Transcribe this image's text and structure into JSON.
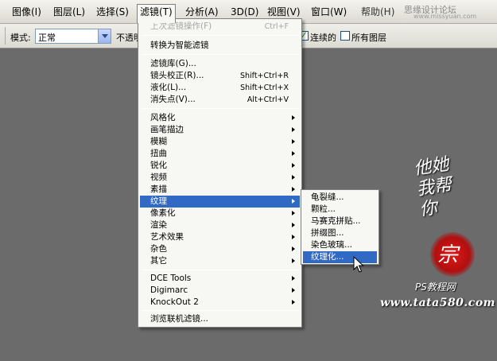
{
  "menubar": {
    "items": [
      "图像(I)",
      "图层(L)",
      "选择(S)",
      "滤镜(T)",
      "分析(A)",
      "3D(D)",
      "视图(V)",
      "窗口(W)",
      "帮助(H)"
    ],
    "active_index": 3
  },
  "site_tag": "思缘设计论坛",
  "site_tag_url": "www.missyuan.com",
  "options": {
    "mode_label": "模式:",
    "mode_value": "正常",
    "opacity_label": "不透明",
    "contiguous_label": "连续的",
    "contiguous_checked": true,
    "all_layers_label": "所有图层",
    "all_layers_checked": false
  },
  "filter_menu": {
    "last_filter": {
      "label": "上次滤镜操作(F)",
      "shortcut": "Ctrl+F",
      "disabled": true
    },
    "smart": "转换为智能滤镜",
    "group1": [
      {
        "label": "滤镜库(G)...",
        "shortcut": ""
      },
      {
        "label": "镜头校正(R)...",
        "shortcut": "Shift+Ctrl+R"
      },
      {
        "label": "液化(L)...",
        "shortcut": "Shift+Ctrl+X"
      },
      {
        "label": "消失点(V)...",
        "shortcut": "Alt+Ctrl+V"
      }
    ],
    "categories": [
      "风格化",
      "画笔描边",
      "模糊",
      "扭曲",
      "锐化",
      "视频",
      "素描",
      "纹理",
      "像素化",
      "渲染",
      "艺术效果",
      "杂色",
      "其它"
    ],
    "highlight_index": 7,
    "plugins": [
      "DCE Tools",
      "Digimarc",
      "KnockOut 2"
    ],
    "browse": "浏览联机滤镜..."
  },
  "texture_submenu": {
    "items": [
      "龟裂缝...",
      "颗粒...",
      "马赛克拼贴...",
      "拼缀图...",
      "染色玻璃...",
      "纹理化..."
    ],
    "highlight_index": 5
  },
  "watermark": {
    "calligraphy": "他她我帮你",
    "seal": "宗",
    "brand": "PS教程网",
    "url": "www.tata580.com"
  }
}
